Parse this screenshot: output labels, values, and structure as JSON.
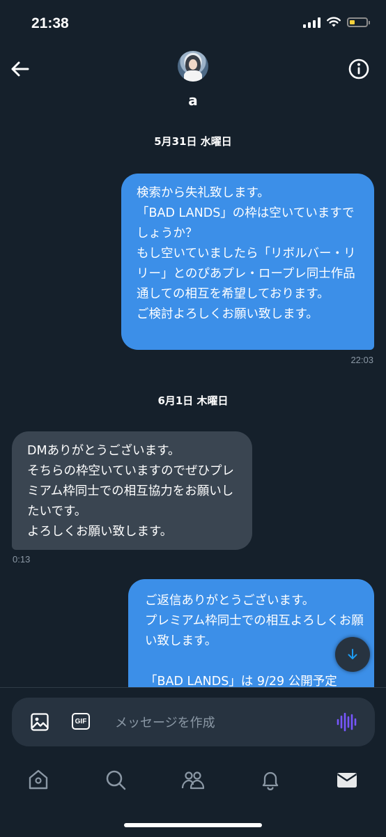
{
  "status_bar": {
    "time": "21:38"
  },
  "conversation": {
    "name": "a"
  },
  "messages": [
    {
      "type": "date",
      "text": "5月31日 水曜日"
    },
    {
      "type": "outgoing",
      "text": "検索から失礼致します。\n「BAD LANDS」の枠は空いていますでしょうか？\nもし空いていましたら「リボルバー・リリー」とのぴあプレ・ロープレ同士作品通しての相互を希望しております。\nご検討よろしくお願い致します。",
      "time": "22:03"
    },
    {
      "type": "date",
      "text": "6月1日 木曜日"
    },
    {
      "type": "incoming",
      "text": "DMありがとうございます。\nそちらの枠空いていますのでぜひプレミアム枠同士での相互協力をお願いしたいです。\nよろしくお願い致します。",
      "time": "0:13"
    },
    {
      "type": "outgoing",
      "text": "ご返信ありがとうございます。\nプレミアム枠同士での相互よろしくお願い致します。\n\n「BAD LANDS」は 9/29 公開予定"
    }
  ],
  "composer": {
    "placeholder": "メッセージを作成"
  },
  "colors": {
    "background": "#15202b",
    "outgoing_bubble": "#3c8fe8",
    "incoming_bubble": "#3a4551",
    "voice_accent": "#7856ff"
  },
  "icons": {
    "header": [
      "back-arrow-icon",
      "info-icon"
    ],
    "composer": [
      "image-icon",
      "gif-icon",
      "voice-wave-icon"
    ],
    "tabs": [
      "home-icon",
      "search-icon",
      "communities-icon",
      "notifications-icon",
      "messages-icon"
    ]
  }
}
